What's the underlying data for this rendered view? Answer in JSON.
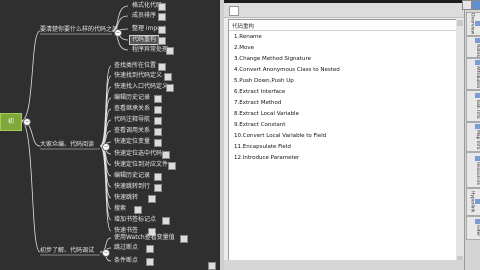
{
  "mindmap": {
    "root": "初",
    "branch_a": "要清楚你要什么样的代码之美",
    "branch_a_children": [
      "格式化代码",
      "成员排序",
      "整理 import",
      "代码重构",
      "程序异常处理"
    ],
    "branch_b": "大家众编、代码阅读",
    "branch_b_children": [
      "查找类所在位置",
      "快速找到代码定义",
      "快速找入口代码定义",
      "编辑历史记录",
      "查看继承关系",
      "代码注释导航",
      "查看调用关系",
      "快速定位变量",
      "快速定位选中代码",
      "快速定位到对应文件",
      "编辑历史记录",
      "快速跳转到行",
      "快速跳转",
      "搜索",
      "增加书签标记点",
      "快速书签"
    ],
    "branch_c": "初步了解、代码调试",
    "branch_c_children": [
      "使用Watch查看变量值",
      "跳过断点",
      "条件断点"
    ]
  },
  "panel": {
    "title": "代码重构",
    "items": [
      "1.Rename",
      "2.Move",
      "3.Change Method Signature",
      "4.Convert Anonymous Class to Nested",
      "5.Push Down,Push Up",
      "6.Extract Interface",
      "7.Extract Method",
      "8.Extract Local Variable",
      "9.Extract Constant",
      "10.Convert Local Variable to Field",
      "11.Encapsulate Field",
      "12.Introduce Parameter"
    ]
  },
  "right_tabs": [
    "Overview",
    "Notes",
    "Attributes",
    "Task Info",
    "Map Info",
    "Resources",
    "Hyperlink",
    "Filter"
  ]
}
